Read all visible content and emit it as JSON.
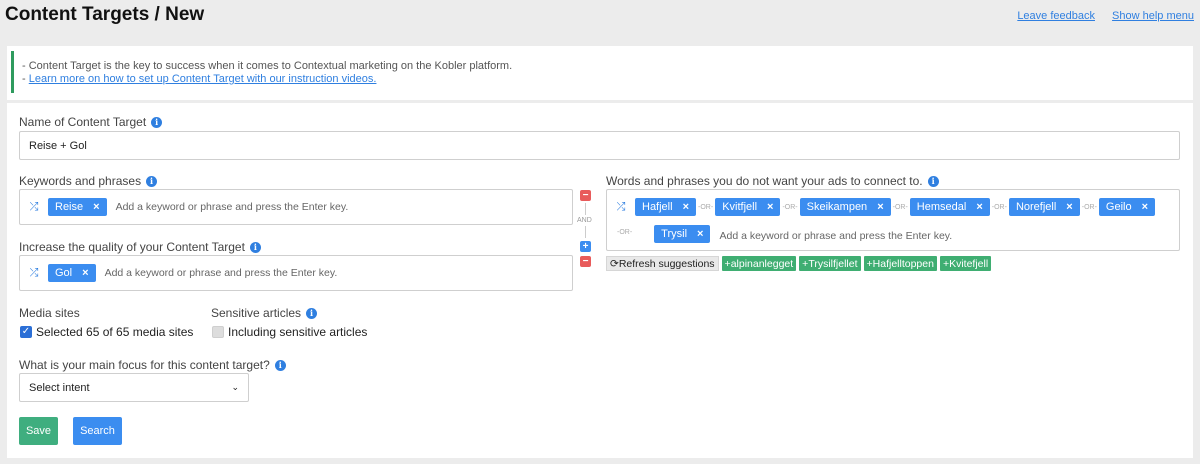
{
  "header": {
    "title": "Content Targets / New",
    "leave_feedback": "Leave feedback",
    "show_help": "Show help menu"
  },
  "info": {
    "line1": "- Content Target is the key to success when it comes to Contextual marketing on the Kobler platform.",
    "line2_prefix": "- ",
    "line2_link": "Learn more on how to set up Content Target with our instruction videos."
  },
  "form": {
    "name_label": "Name of Content Target",
    "name_value": "Reise + Gol",
    "keywords_label": "Keywords and phrases",
    "keywords_tags": [
      "Reise"
    ],
    "keywords_placeholder": "Add a keyword or phrase and press the Enter key.",
    "and_text": "AND",
    "quality_label": "Increase the quality of your Content Target",
    "quality_tags": [
      "Gol"
    ],
    "quality_placeholder": "Add a keyword or phrase and press the Enter key.",
    "negative_label": "Words and phrases you do not want your ads to connect to.",
    "negative_tags": [
      "Hafjell",
      "Kvitfjell",
      "Skeikampen",
      "Hemsedal",
      "Norefjell",
      "Geilo",
      "Trysil"
    ],
    "or_text": "-OR-",
    "negative_placeholder": "Add a keyword or phrase and press the Enter key.",
    "refresh_label": "Refresh suggestions",
    "suggestions": [
      "alpinanlegget",
      "Trysilfjellet",
      "Hafjelltoppen",
      "Kvitefjell"
    ],
    "media_label": "Media sites",
    "media_checkbox": "Selected 65 of 65 media sites",
    "media_checked": true,
    "sensitive_label": "Sensitive articles",
    "sensitive_checkbox": "Including sensitive articles",
    "sensitive_checked": false,
    "focus_label": "What is your main focus for this content target?",
    "intent_selected": "Select intent",
    "save_label": "Save",
    "search_label": "Search"
  },
  "colors": {
    "accent": "#3b8df0",
    "success": "#3fae72",
    "danger": "#e85b5b",
    "link": "#2f7fe0"
  }
}
